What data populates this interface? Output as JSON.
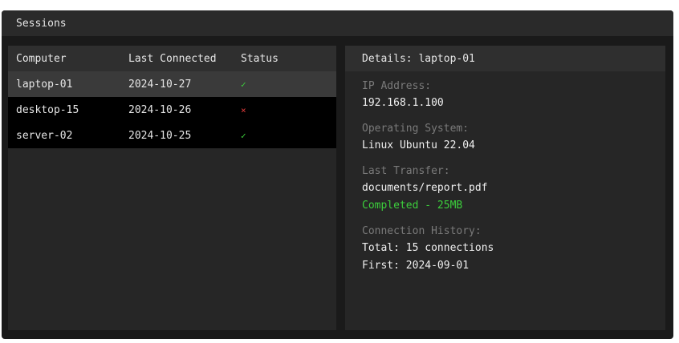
{
  "window": {
    "title": "Sessions"
  },
  "table": {
    "headers": {
      "computer": "Computer",
      "last_connected": "Last Connected",
      "status": "Status"
    },
    "rows": [
      {
        "computer": "laptop-01",
        "last_connected": "2024-10-27",
        "status": "✓"
      },
      {
        "computer": "desktop-15",
        "last_connected": "2024-10-26",
        "status": "×"
      },
      {
        "computer": "server-02",
        "last_connected": "2024-10-25",
        "status": "✓"
      }
    ]
  },
  "details": {
    "title": "Details: laptop-01",
    "ip_label": "IP Address:",
    "ip_value": "192.168.1.100",
    "os_label": "Operating System:",
    "os_value": "Linux Ubuntu 22.04",
    "transfer_label": "Last Transfer:",
    "transfer_file": "documents/report.pdf",
    "transfer_status": "Completed - 25MB",
    "history_label": "Connection History:",
    "history_total": "Total: 15 connections",
    "history_first": "First: 2024-09-01"
  },
  "colors": {
    "ok": "#3ccf3c",
    "error": "#e23b3b",
    "selected_row": "#3a3a3a"
  }
}
